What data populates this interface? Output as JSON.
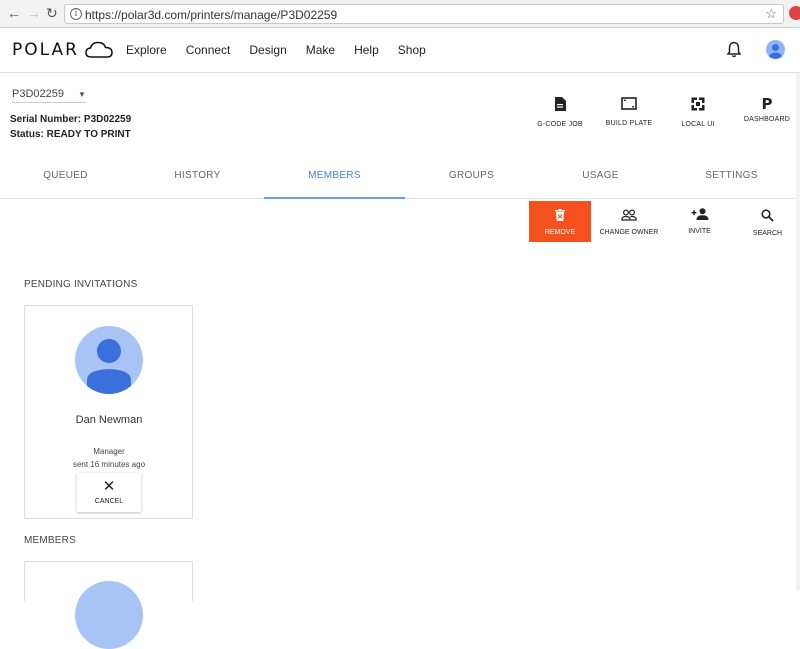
{
  "browser": {
    "url": "https://polar3d.com/printers/manage/P3D02259"
  },
  "header": {
    "logo_text": "POLAR",
    "nav": [
      "Explore",
      "Connect",
      "Design",
      "Make",
      "Help",
      "Shop"
    ]
  },
  "printer": {
    "selected": "P3D02259",
    "serial": "Serial Number: P3D02259",
    "status": "Status: READY TO PRINT"
  },
  "tools": [
    "G-CODE JOB",
    "BUILD PLATE",
    "LOCAL UI",
    "DASHBOARD"
  ],
  "tabs": [
    "QUEUED",
    "HISTORY",
    "MEMBERS",
    "GROUPS",
    "USAGE",
    "SETTINGS"
  ],
  "active_tab": "MEMBERS",
  "actions": [
    "REMOVE",
    "CHANGE OWNER",
    "INVITE",
    "SEARCH"
  ],
  "pending": {
    "heading": "PENDING INVITATIONS",
    "name": "Dan Newman",
    "role": "Manager",
    "sent": "sent 16 minutes ago",
    "cancel_label": "CANCEL"
  },
  "members": {
    "heading": "MEMBERS"
  },
  "colors": {
    "accent": "#4a7de8",
    "remove": "#f4511e",
    "avatar": "#a8c4f6"
  }
}
